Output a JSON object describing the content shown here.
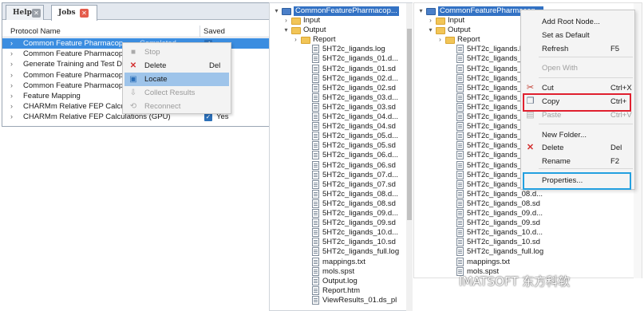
{
  "jobs_panel": {
    "tabs": [
      {
        "label": "Help",
        "close_color": "#9aa0a8"
      },
      {
        "label": "Jobs",
        "close_color": "#e45c4c"
      }
    ],
    "columns": [
      "Protocol Name",
      "Saved"
    ],
    "rows": [
      {
        "name": "Common Feature Pharmacop",
        "saved_extra": "Completed",
        "selected": true
      },
      {
        "name": "Common Feature Pharmacop",
        "saved_extra": ""
      },
      {
        "name": "Generate Training and Test D",
        "saved_extra": ""
      },
      {
        "name": "Common Feature Pharmacop",
        "saved_extra": ""
      },
      {
        "name": "Common Feature Pharmacop",
        "saved_extra": ""
      },
      {
        "name": "Feature Mapping",
        "saved_extra": ""
      },
      {
        "name": "CHARMm Relative FEP Calcul",
        "saved_extra": ""
      },
      {
        "name": "CHARMm Relative FEP Calculations (GPU)",
        "saved_extra": "Yes"
      }
    ],
    "context_menu": [
      {
        "label": "Stop",
        "shortcut": "",
        "icon": "stop-icon",
        "disabled": true
      },
      {
        "label": "Delete",
        "shortcut": "Del",
        "icon": "delete-x-icon",
        "disabled": false
      },
      {
        "label": "Locate",
        "shortcut": "",
        "icon": "locate-icon",
        "disabled": false,
        "highlighted": true
      },
      {
        "label": "Collect Results",
        "shortcut": "",
        "icon": "collect-results-icon",
        "disabled": true
      },
      {
        "label": "Reconnect",
        "shortcut": "",
        "icon": "reconnect-icon",
        "disabled": true
      }
    ]
  },
  "explorer_left": {
    "root": "CommonFeaturePharmacop...",
    "items": [
      "Input",
      "Output",
      "Report",
      "5HT2c_ligands.log",
      "5HT2c_ligands_01.d...",
      "5HT2c_ligands_01.sd",
      "5HT2c_ligands_02.d...",
      "5HT2c_ligands_02.sd",
      "5HT2c_ligands_03.d...",
      "5HT2c_ligands_03.sd",
      "5HT2c_ligands_04.d...",
      "5HT2c_ligands_04.sd",
      "5HT2c_ligands_05.d...",
      "5HT2c_ligands_05.sd",
      "5HT2c_ligands_06.d...",
      "5HT2c_ligands_06.sd",
      "5HT2c_ligands_07.d...",
      "5HT2c_ligands_07.sd",
      "5HT2c_ligands_08.d...",
      "5HT2c_ligands_08.sd",
      "5HT2c_ligands_09.d...",
      "5HT2c_ligands_09.sd",
      "5HT2c_ligands_10.d...",
      "5HT2c_ligands_10.sd",
      "5HT2c_ligands_full.log",
      "mappings.txt",
      "mols.spst",
      "Output.log",
      "Report.htm",
      "ViewResults_01.ds_pl"
    ]
  },
  "explorer_right": {
    "root": "CommonFeaturePharmacop...",
    "items": [
      "Input",
      "Output",
      "Report",
      "5HT2c_ligands.log",
      "5HT2c_ligands_0",
      "5HT2c_ligands_0",
      "5HT2c_ligands_0",
      "5HT2c_ligands_0",
      "5HT2c_ligands_0",
      "5HT2c_ligands_0",
      "5HT2c_ligands_0",
      "5HT2c_ligands_0",
      "5HT2c_ligands_0",
      "5HT2c_ligands_0",
      "5HT2c_ligands_0",
      "5HT2c_ligands_0",
      "5HT2c_ligands_0",
      "5HT2c_ligands_0",
      "5HT2c_ligands_08.d...",
      "5HT2c_ligands_08.sd",
      "5HT2c_ligands_09.d...",
      "5HT2c_ligands_09.sd",
      "5HT2c_ligands_10.d...",
      "5HT2c_ligands_10.sd",
      "5HT2c_ligands_full.log",
      "mappings.txt",
      "mols.spst"
    ],
    "context_menu": [
      {
        "label": "Add Root Node...",
        "shortcut": "",
        "disabled": false
      },
      {
        "label": "Set as Default",
        "shortcut": "",
        "disabled": false
      },
      {
        "label": "Refresh",
        "shortcut": "F5",
        "disabled": false
      },
      {
        "label": "Open With",
        "shortcut": "",
        "disabled": true,
        "submenu": true
      },
      {
        "label": "Cut",
        "shortcut": "Ctrl+X",
        "disabled": false,
        "icon": "scissors-icon"
      },
      {
        "label": "Copy",
        "shortcut": "Ctrl+",
        "disabled": false,
        "icon": "copy-icon"
      },
      {
        "label": "Paste",
        "shortcut": "Ctrl+V",
        "disabled": true,
        "icon": "paste-icon"
      },
      {
        "label": "New Folder...",
        "shortcut": "",
        "disabled": false
      },
      {
        "label": "Delete",
        "shortcut": "Del",
        "disabled": false,
        "icon": "delete-x-icon"
      },
      {
        "label": "Rename",
        "shortcut": "F2",
        "disabled": false
      },
      {
        "label": "Properties...",
        "shortcut": "",
        "disabled": false
      }
    ]
  },
  "watermark": {
    "text": "IMATSOFT 东方科软"
  },
  "colors": {
    "selection": "#3b8de0",
    "highlight_red": "#e0202f",
    "highlight_blue": "#23a0e0",
    "folder": "#f2c557"
  }
}
